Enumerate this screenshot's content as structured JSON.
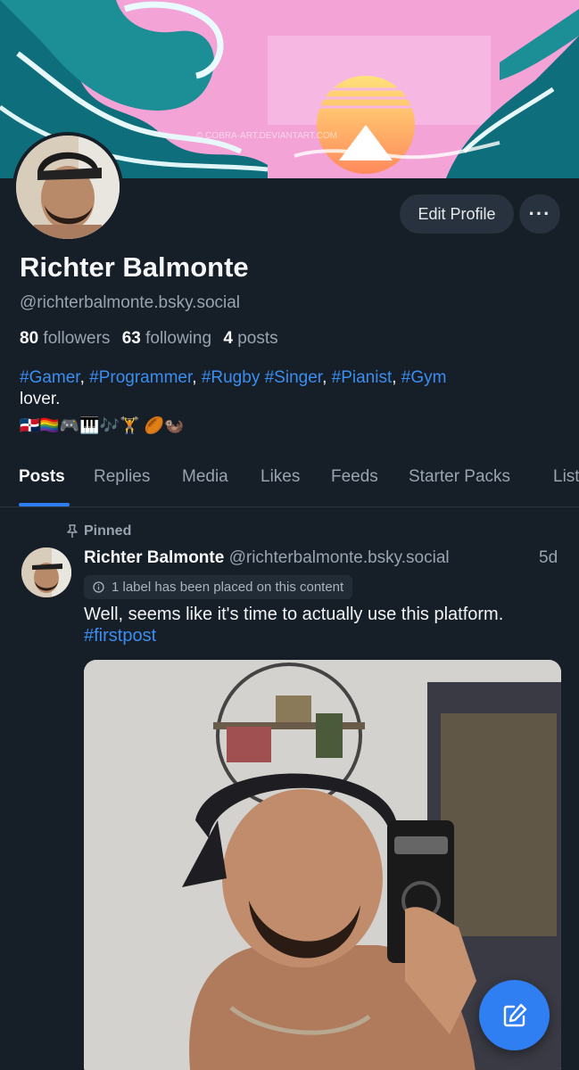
{
  "banner": {
    "watermark": "© COBRA-ART.DEVIANTART.COM"
  },
  "profile": {
    "display_name": "Richter Balmonte",
    "handle": "@richterbalmonte.bsky.social",
    "followers_count": "80",
    "followers_label": "followers",
    "following_count": "63",
    "following_label": "following",
    "posts_count": "4",
    "posts_label": "posts",
    "bio_tags": [
      "#Gamer",
      "#Programmer",
      "#Rugby",
      "#Singer",
      "#Pianist",
      "#Gym"
    ],
    "bio_suffix": "lover.",
    "bio_emojis": "🇩🇴🏳️‍🌈🎮🎹🎶🏋️ 🏉🦦"
  },
  "actions": {
    "edit_profile": "Edit Profile",
    "more": "···"
  },
  "tabs": [
    "Posts",
    "Replies",
    "Media",
    "Likes",
    "Feeds",
    "Starter Packs",
    "Lists"
  ],
  "active_tab": "Posts",
  "post": {
    "pinned_label": "Pinned",
    "author": "Richter Balmonte",
    "handle": "@richterbalmonte.bsky.social",
    "time": "5d",
    "label_notice": "1 label has been placed on this content",
    "text": "Well, seems like it's time to actually use this platform.",
    "hashtag": "#firstpost"
  },
  "icons": {
    "pin": "pin-icon",
    "info": "info-icon",
    "compose": "compose-icon"
  },
  "colors": {
    "background": "#161e27",
    "accent": "#2e7ef2",
    "link": "#3b8ef0",
    "muted": "#98a4b1"
  }
}
